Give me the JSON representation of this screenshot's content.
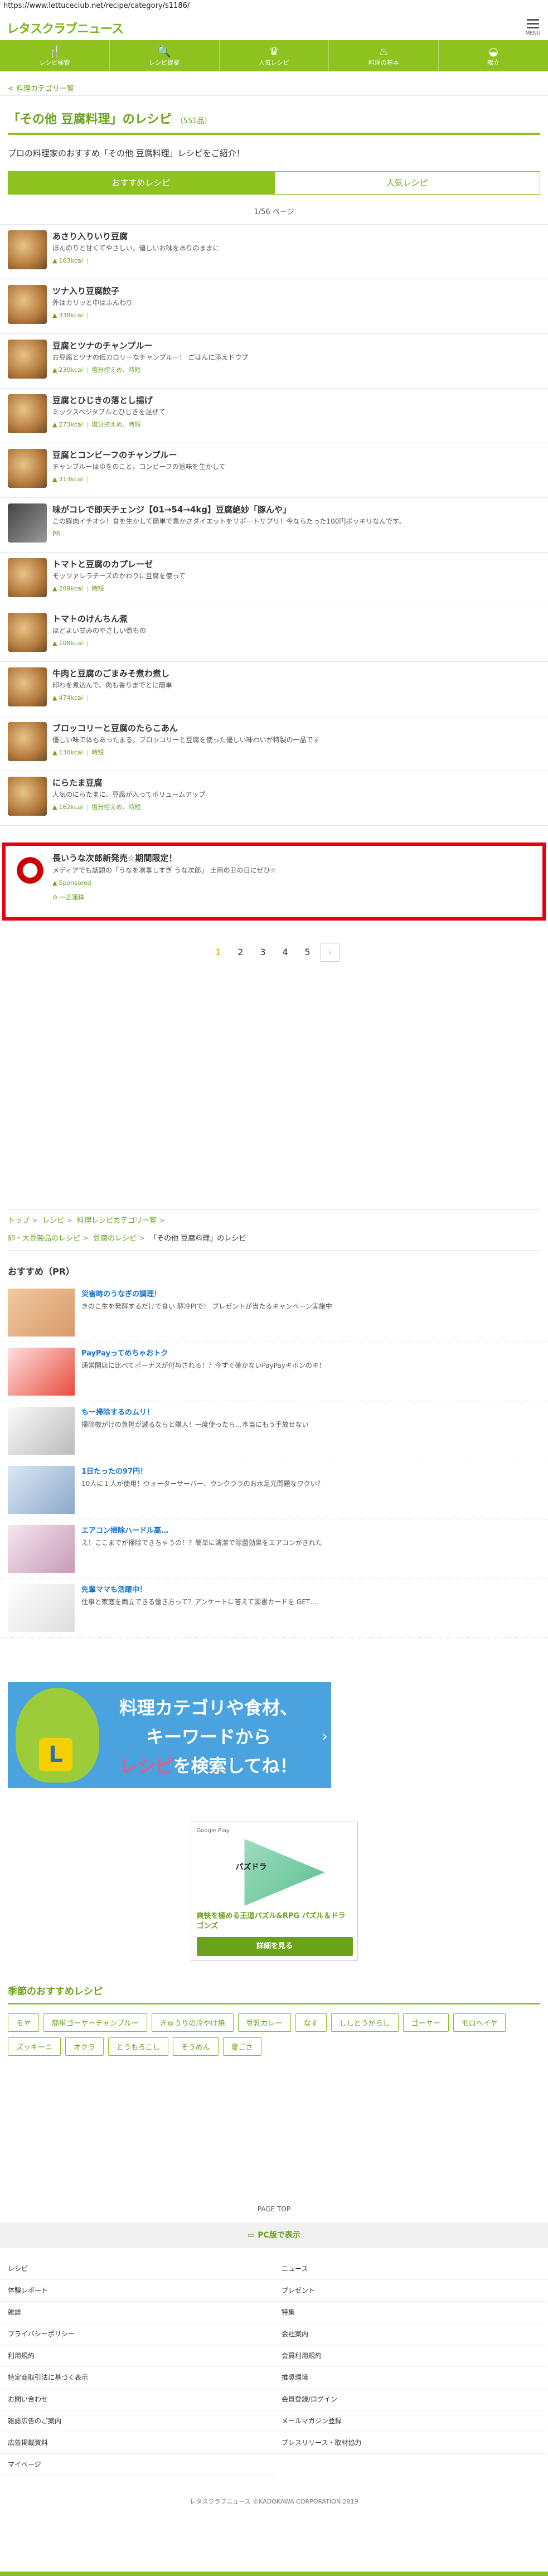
{
  "url": "https://www.lettuceclub.net/recipe/category/s1186/",
  "header": {
    "logo": "レタスクラブニュース",
    "menu_label": "MENU"
  },
  "nav": [
    {
      "label": "レシピ検索",
      "icon": "fork-knife-icon",
      "glyph": "🍴"
    },
    {
      "label": "レシピ提案",
      "icon": "search-icon",
      "glyph": "🔍"
    },
    {
      "label": "人気レシピ",
      "icon": "crown-icon",
      "glyph": "♛"
    },
    {
      "label": "料理の基本",
      "icon": "pot-icon",
      "glyph": "♨"
    },
    {
      "label": "献立",
      "icon": "bowl-icon",
      "glyph": "◒"
    }
  ],
  "back_link": "< 料理カテゴリ一覧",
  "title": "「その他 豆腐料理」のレシピ",
  "title_count": "（551品）",
  "lead": "プロの料理家のおすすめ「その他 豆腐料理」レシピをご紹介！",
  "tabs": [
    {
      "label": "おすすめレシピ"
    },
    {
      "label": "人気レシピ"
    }
  ],
  "page_info": "1/56 ページ",
  "recipes": [
    {
      "name": "あさり入りいり豆腐",
      "desc": "ほんのりと甘くてやさしい。優しいお味をありのままに",
      "kcal": "163kcal",
      "time": ""
    },
    {
      "name": "ツナ入り豆腐餃子",
      "desc": "外はカリッと中はふんわり",
      "kcal": "338kcal",
      "time": ""
    },
    {
      "name": "豆腐とツナのチャンプルー",
      "desc": "お豆腐とツナの低カロリーなチャンプルー！ ごはんに添えドウプ",
      "kcal": "230kcal",
      "time": "塩分控えめ、時短"
    },
    {
      "name": "豆腐とひじきの落とし揚げ",
      "desc": "ミックスベジタブルとひじきを混ぜて",
      "kcal": "273kcal",
      "time": "塩分控えめ、時短"
    },
    {
      "name": "豆腐とコンビーフのチャンプルー",
      "desc": "チャンプルーはゆをのこと。コンビーフの旨味を生かして",
      "kcal": "313kcal",
      "time": ""
    },
    {
      "name": "味がコレで即天チェンジ【01→54→4kg】豆腐絶妙「豚んや」",
      "desc": "この豚肉イチオシ！食を生かして簡単で豊かさダイエットをサポートサプリ！今ならたった100円ポッキリなんです。",
      "kcal": "",
      "time": "PR"
    },
    {
      "name": "トマトと豆腐のカプレーゼ",
      "desc": "モッツァレラチーズのかわりに豆腐を使って",
      "kcal": "209kcal",
      "time": "時短"
    },
    {
      "name": "トマトのけんちん煮",
      "desc": "ほどよい甘みのやさしい煮もの",
      "kcal": "108kcal",
      "time": ""
    },
    {
      "name": "牛肉と豆腐のごまみそ煮わ煮し",
      "desc": "印わを煮込んで、肉も香りまでとに簡単",
      "kcal": "474kcal",
      "time": ""
    },
    {
      "name": "ブロッコリーと豆腐のたらこあん",
      "desc": "優しい味で体もあったまる。ブロッコリーと豆腐を使った優しい味わいが特製の一品です",
      "kcal": "136kcal",
      "time": "時短"
    },
    {
      "name": "にらたま豆腐",
      "desc": "人気のにらたまに、豆腐が入ってボリュームアップ",
      "kcal": "162kcal",
      "time": "塩分控えめ、時短"
    }
  ],
  "ad": {
    "name": "長いうな次郎新発売☆期間限定！",
    "desc": "メディアでも話題の「うなを凛事しすぎ うな次郎」",
    "desc2": "土用の丑の日にぜひ☆",
    "sponsor": "Sponsored",
    "link": "一正蒲鉾"
  },
  "pager": {
    "pages": [
      "1",
      "2",
      "3",
      "4",
      "5"
    ],
    "next": "›"
  },
  "breadcrumb": {
    "line1": [
      "トップ",
      "レシピ",
      "料理レシピカテゴリ一覧"
    ],
    "line2": [
      "卵・大豆製品のレシピ",
      "豆腐のレシピ"
    ],
    "current": "「その他 豆腐料理」のレシピ"
  },
  "pr_title": "おすすめ（PR）",
  "pr_items": [
    {
      "title": "災害時のうなぎの調理！",
      "desc": "きのこ生を発酵するだけで食い 酵冷PIで！ プレゼントが当たるキャンペーン実施中"
    },
    {
      "title": "PayPayってめちゃおトク",
      "desc": "通常開店に比べてポーナスが付与される！？今すぐ確かないPayPayキボンのキ！"
    },
    {
      "title": "もー掃除するのムリ！",
      "desc": "掃除機がけの負担が減るならと購入！一度使ったら…本当にもう手放せない"
    },
    {
      "title": "1日たったの97円！",
      "desc": "10人に１人が使用！ウォーターサーバー、ウンクララのお水足元問題なワクい？"
    },
    {
      "title": "エアコン掃除ハードル高…",
      "desc": "え！ここまでが掃除できちゃうの！？簡単に清潔で除菌効果をエアコンがきれた"
    },
    {
      "title": "先輩ママも活躍中！",
      "desc": "仕事と家庭を両立できる働き方って？アンケートに答えて図書カードを GET…"
    }
  ],
  "banner": {
    "line1": "料理カテゴリや食材、",
    "line2": "キーワードから",
    "line3a": "レシピ",
    "line3b": "を検索してね！",
    "logo": "L"
  },
  "game_ad": {
    "store": "Google Play",
    "title": "パズドラ",
    "desc": "爽快を極める王道パズル&RPG パズル＆ドラゴンズ",
    "button": "詳細を見る"
  },
  "season_title": "季節のおすすめレシピ",
  "season_tags": [
    "モヤ",
    "簡単ゴーヤーチャンプルー",
    "きゅうりの冷やけ焼",
    "豆乳カレー",
    "なす",
    "ししとうがらし",
    "ゴーヤー",
    "モロヘイヤ",
    "ズッキーニ",
    "オクラ",
    "とうもろこし",
    "そうめん",
    "夏ごさ"
  ],
  "page_top": "PAGE TOP",
  "pc_view": "PC版で表示",
  "footer": [
    "レシピ",
    "ニュース",
    "体験レポート",
    "プレゼント",
    "雑誌",
    "特集",
    "プライバシーポリシー",
    "会社案内",
    "利用規約",
    "会員利用規約",
    "特定商取引法に基づく表示",
    "推奨環境",
    "お問い合わせ",
    "会員登録/ログイン",
    "雑誌広告のご案内",
    "メールマガジン登録",
    "広告掲載資料",
    "プレスリリース・取材協力",
    "マイページ"
  ],
  "copyright": "レタスクラブニュース ©KADOKAWA CORPORATION 2019",
  "colors": {
    "brand": "#8dc21f",
    "brand_text": "#6aa21b",
    "ad_border": "#e60012"
  }
}
